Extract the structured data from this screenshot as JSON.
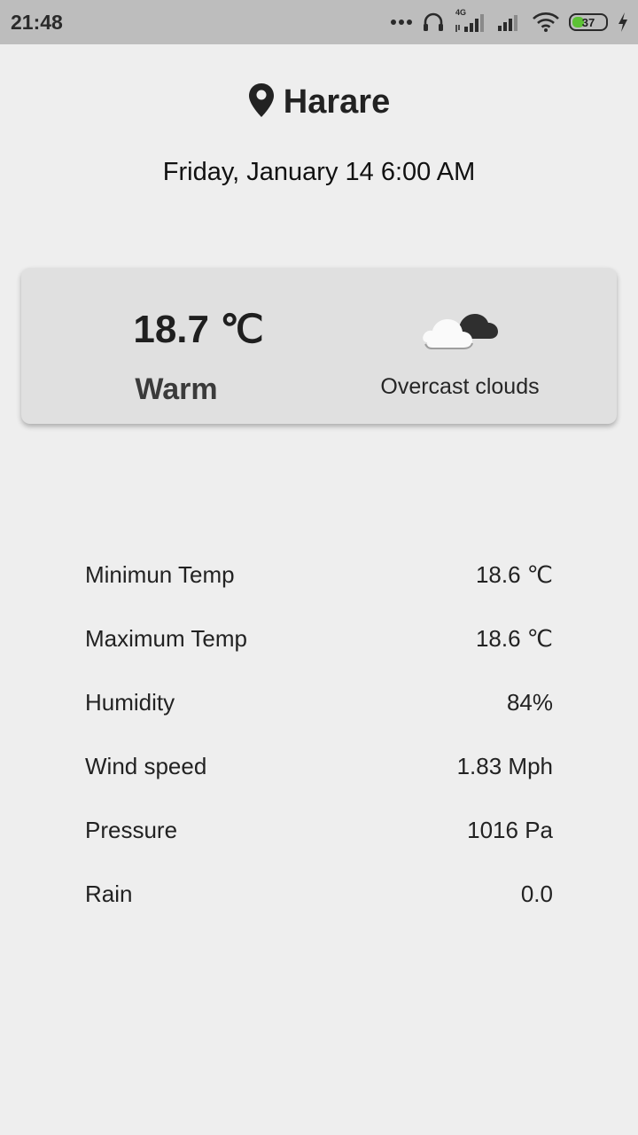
{
  "status_bar": {
    "time": "21:48",
    "network_label": "4G",
    "battery_percent": "37",
    "battery_level": 0.37,
    "icons": [
      "more-dots-icon",
      "headset-icon",
      "signal-4g-icon",
      "signal-icon",
      "wifi-icon",
      "battery-icon",
      "charging-bolt-icon"
    ]
  },
  "header": {
    "icon": "location-pin-icon",
    "city": "Harare",
    "datetime": "Friday, January 14 6:00 AM"
  },
  "current": {
    "temperature": "18.7 ℃",
    "feel": "Warm",
    "icon": "overcast-clouds-icon",
    "description": "Overcast clouds"
  },
  "details": [
    {
      "label": "Minimun Temp",
      "value": "18.6 ℃"
    },
    {
      "label": "Maximum Temp",
      "value": "18.6 ℃"
    },
    {
      "label": "Humidity",
      "value": "84%"
    },
    {
      "label": "Wind speed",
      "value": "1.83 Mph"
    },
    {
      "label": "Pressure",
      "value": "1016 Pa"
    },
    {
      "label": "Rain",
      "value": "0.0"
    }
  ],
  "colors": {
    "background": "#eeeeee",
    "status_bar": "#bdbdbd",
    "card": "#e0e0e0",
    "battery": "#5dc235"
  }
}
